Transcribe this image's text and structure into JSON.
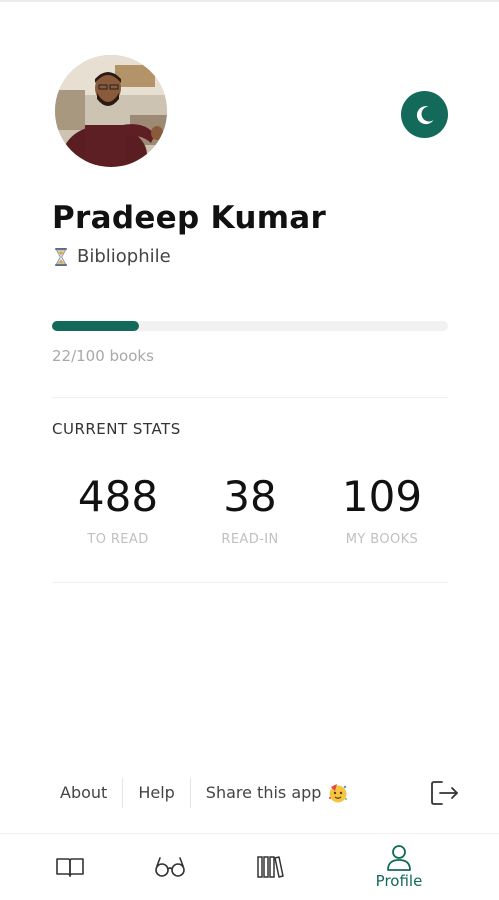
{
  "profile": {
    "name": "Pradeep Kumar",
    "title": "Bibliophile",
    "avatar_icon": "user-photo",
    "title_icon": "hourglass-icon"
  },
  "theme_toggle": {
    "icon": "moon-icon"
  },
  "progress": {
    "label": "22/100 books",
    "read": 22,
    "goal": 100
  },
  "stats": {
    "heading": "CURRENT STATS",
    "items": [
      {
        "value": "488",
        "label": "TO READ"
      },
      {
        "value": "38",
        "label": "READ-IN"
      },
      {
        "value": "109",
        "label": "MY BOOKS"
      }
    ]
  },
  "footer": {
    "links": [
      {
        "label": "About"
      },
      {
        "label": "Help"
      },
      {
        "label": "Share this app",
        "icon": "party-face-icon"
      }
    ],
    "logout_icon": "logout-icon"
  },
  "nav": {
    "items": [
      {
        "icon": "open-book-icon",
        "label": ""
      },
      {
        "icon": "glasses-icon",
        "label": ""
      },
      {
        "icon": "bookshelf-icon",
        "label": ""
      },
      {
        "icon": "profile-icon",
        "label": "Profile",
        "active": true
      }
    ]
  },
  "colors": {
    "accent": "#136a5a",
    "muted_text": "#a8a8a8",
    "track": "#f1f1f1"
  }
}
